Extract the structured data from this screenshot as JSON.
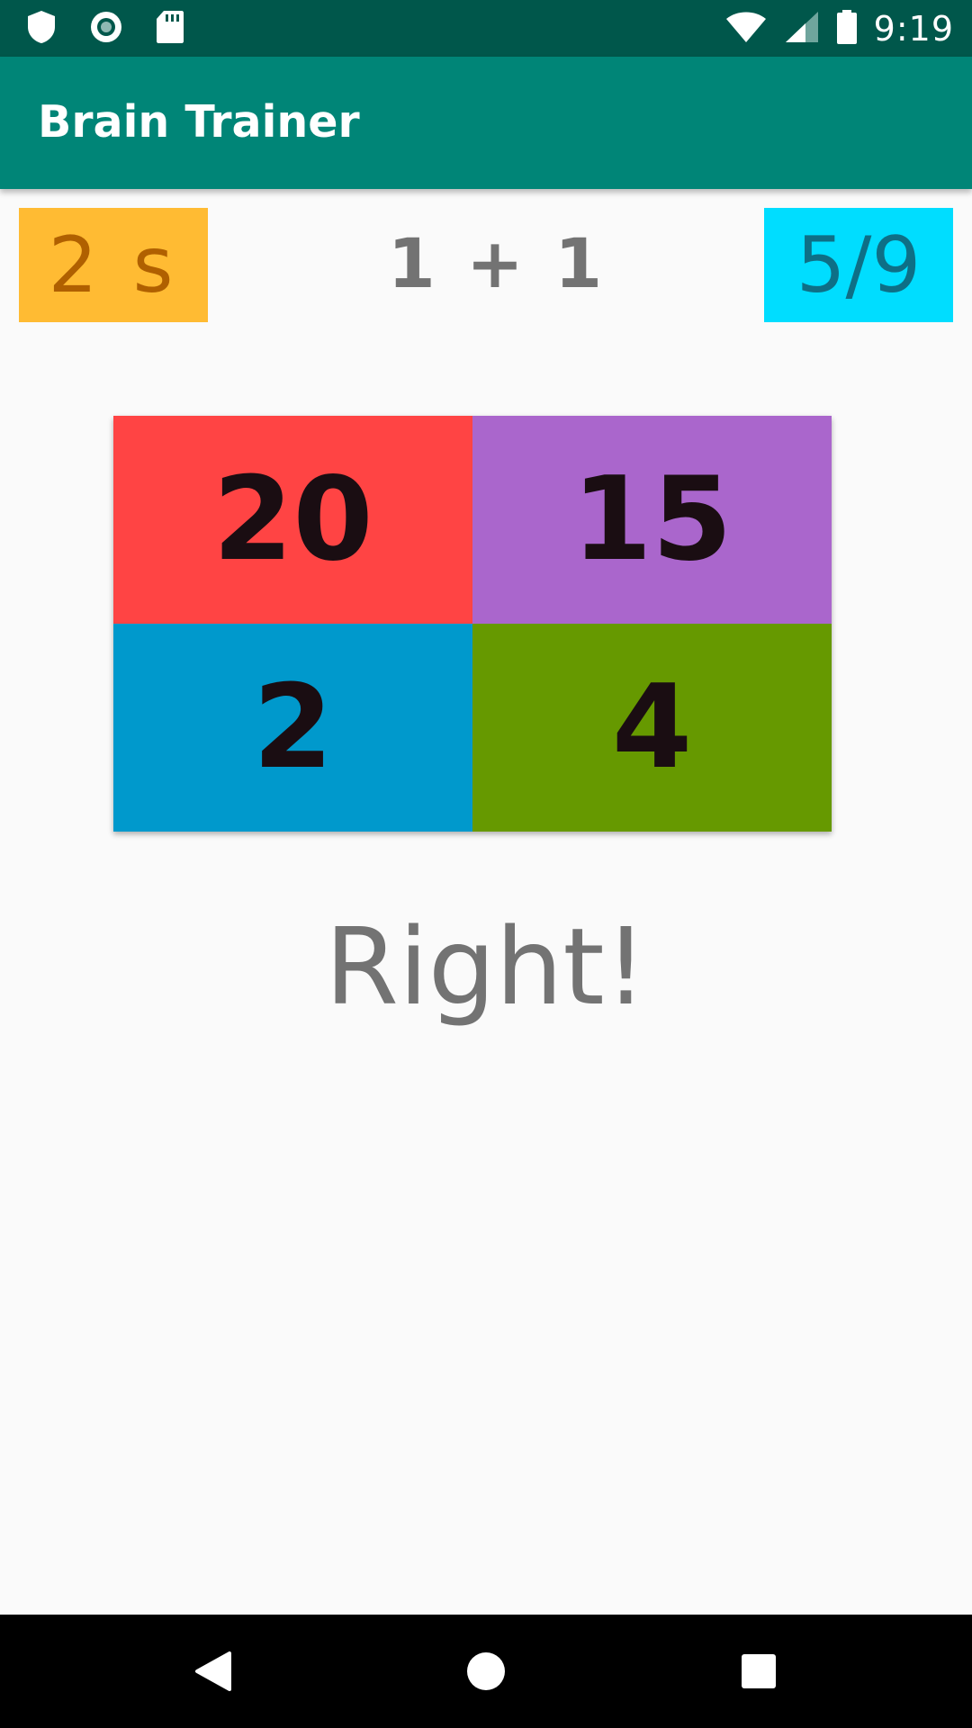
{
  "status_bar": {
    "time": "9:19",
    "icons": [
      "shield-icon",
      "circle-record-icon",
      "sd-card-icon",
      "wifi-icon",
      "signal-icon",
      "battery-icon"
    ]
  },
  "app_bar": {
    "title": "Brain Trainer",
    "color": "#008577"
  },
  "game": {
    "timer": "2 s",
    "timer_color": "#ffbb33",
    "question": "1 +  1",
    "score": "5/9",
    "score_color": "#00ddff",
    "answers": [
      {
        "label": "20",
        "color": "#ff4444"
      },
      {
        "label": "15",
        "color": "#aa66cc"
      },
      {
        "label": "2",
        "color": "#0099cc"
      },
      {
        "label": "4",
        "color": "#669900"
      }
    ],
    "result": "Right!"
  },
  "nav_bar": {
    "icons": [
      "back-icon",
      "home-icon",
      "recents-icon"
    ]
  }
}
